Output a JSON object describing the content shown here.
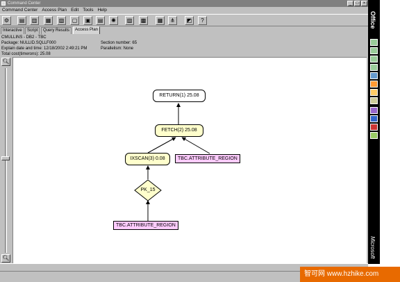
{
  "title_bar": {
    "title": "Command Center",
    "buttons": [
      "_",
      "□",
      "×"
    ]
  },
  "menu": [
    "Command Center",
    "Access Plan",
    "Edit",
    "Tools",
    "Help"
  ],
  "toolbar_icons": [
    "run-icon",
    "script-icon",
    "history-icon",
    "results-icon",
    "options-icon",
    "new-icon",
    "open-icon",
    "save-icon",
    "settings-icon",
    "export-icon",
    "print-icon",
    "graph-icon",
    "tree-icon",
    "analyze-icon",
    "help-icon"
  ],
  "tabs": [
    "Interactive",
    "Script",
    "Query Results",
    "Access Plan"
  ],
  "active_tab": "Access Plan",
  "info": {
    "line1": "CMULLINS - DB2 - TBC",
    "line2": "Package: NULLID.SQLLF000",
    "line3": "Explain date and time: 12/18/2002 2:49:21 PM",
    "line4": "Total cost(timerons): 25.08",
    "section": "Section number: 65",
    "parallelism": "Parallelism: None"
  },
  "plan": {
    "return": "RETURN(1) 25.08",
    "fetch": "FETCH(2) 25.08",
    "ixscan": "IXSCAN(3) 0.08",
    "table1": "TBC.ATTRIBUTE_REGION",
    "index": "PK_15",
    "table2": "TBC.ATTRIBUTE_REGION"
  },
  "office_bar": {
    "brand": "Office",
    "vendor": "Microsoft"
  },
  "watermark": "智可网 www.hzhike.com",
  "colors": {
    "operator_fill": "#ffffcc",
    "table_fill": "#ffccff",
    "return_fill": "#ffffff"
  }
}
